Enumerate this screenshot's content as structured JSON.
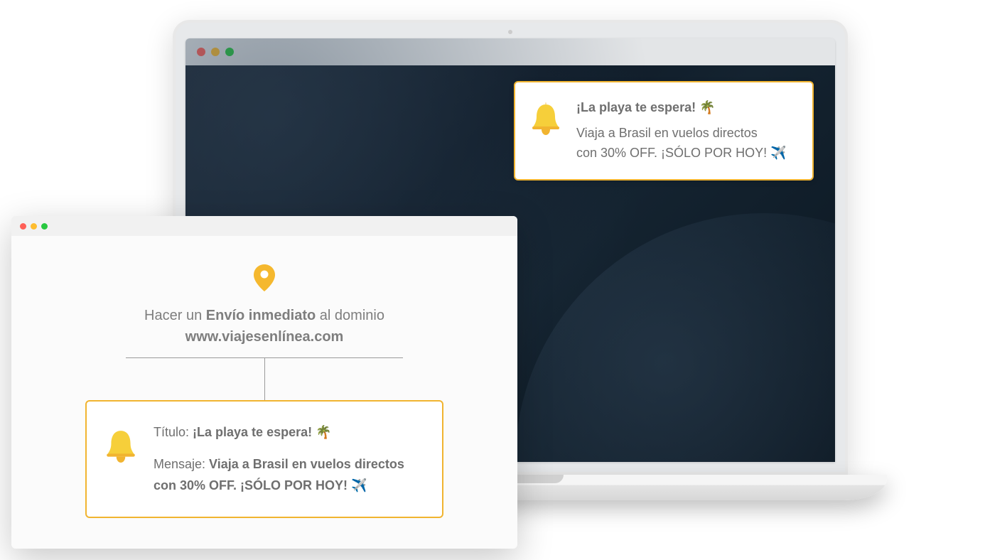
{
  "laptop_notification": {
    "title": "¡La playa te espera! 🌴",
    "message_line1": "Viaja a Brasil en vuelos directos",
    "message_line2": "con 30% OFF. ¡SÓLO POR HOY! ✈️"
  },
  "editor": {
    "headline_prefix": "Hacer un ",
    "headline_bold": "Envío inmediato",
    "headline_suffix": " al dominio",
    "domain": "www.viajesenlínea.com",
    "title_label": "Título: ",
    "title_value": "¡La playa te espera! 🌴",
    "message_label": "Mensaje: ",
    "message_value_line1": "Viaja a Brasil en vuelos directos",
    "message_value_line2": "con 30% OFF. ¡SÓLO POR HOY! ✈️"
  },
  "colors": {
    "accent": "#f1b430"
  }
}
